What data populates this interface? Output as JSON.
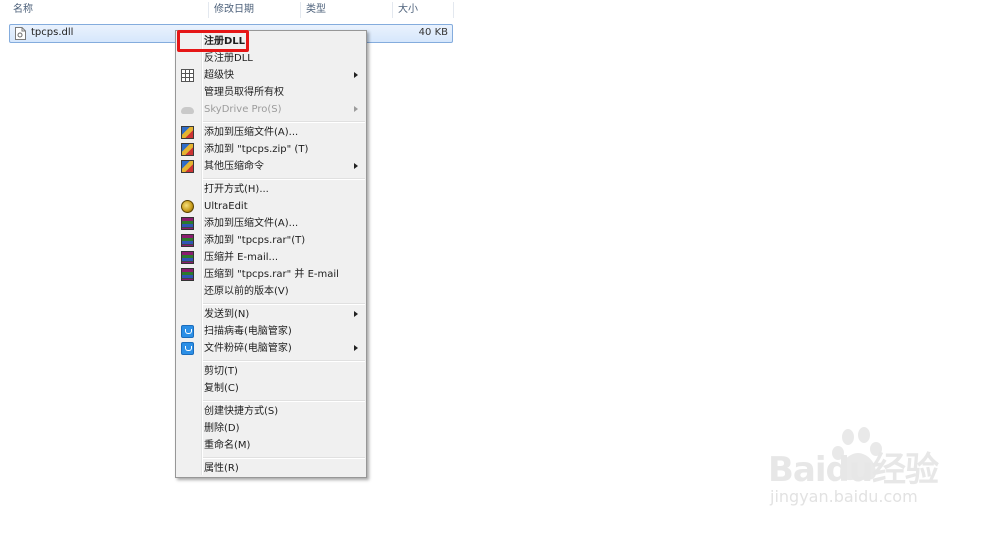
{
  "columns": {
    "name": "名称",
    "modified": "修改日期",
    "type": "类型",
    "size": "大小"
  },
  "file": {
    "name": "tpcps.dll",
    "size": "40 KB",
    "icon": "dll-file-icon"
  },
  "menu": {
    "items": [
      {
        "label": "注册DLL",
        "bold": true,
        "icon": ""
      },
      {
        "label": "反注册DLL",
        "icon": ""
      },
      {
        "label": "超级快",
        "icon": "grid-icon",
        "submenu": true
      },
      {
        "label": "管理员取得所有权",
        "icon": ""
      },
      {
        "label": "SkyDrive Pro(S)",
        "icon": "cloud-icon",
        "submenu": true,
        "disabled": true
      },
      {
        "label": "添加到压缩文件(A)...",
        "icon": "winrar-box-icon"
      },
      {
        "label": "添加到 \"tpcps.zip\" (T)",
        "icon": "winrar-box-icon"
      },
      {
        "label": "其他压缩命令",
        "icon": "winrar-box-icon",
        "submenu": true
      },
      {
        "label": "打开方式(H)...",
        "icon": ""
      },
      {
        "label": "UltraEdit",
        "icon": "ultraedit-icon"
      },
      {
        "label": "添加到压缩文件(A)...",
        "icon": "winrar-books-icon"
      },
      {
        "label": "添加到 \"tpcps.rar\"(T)",
        "icon": "winrar-books-icon"
      },
      {
        "label": "压缩并 E-mail...",
        "icon": "winrar-books-icon"
      },
      {
        "label": "压缩到 \"tpcps.rar\" 并 E-mail",
        "icon": "winrar-books-icon"
      },
      {
        "label": "还原以前的版本(V)",
        "icon": ""
      },
      {
        "label": "发送到(N)",
        "icon": "",
        "submenu": true
      },
      {
        "label": "扫描病毒(电脑管家)",
        "icon": "shield-icon"
      },
      {
        "label": "文件粉碎(电脑管家)",
        "icon": "shield-icon",
        "submenu": true
      },
      {
        "label": "剪切(T)",
        "icon": ""
      },
      {
        "label": "复制(C)",
        "icon": ""
      },
      {
        "label": "创建快捷方式(S)",
        "icon": ""
      },
      {
        "label": "删除(D)",
        "icon": ""
      },
      {
        "label": "重命名(M)",
        "icon": ""
      },
      {
        "label": "属性(R)",
        "icon": ""
      }
    ]
  },
  "watermark": {
    "brand": "Baidu经验",
    "url": "jingyan.baidu.com"
  },
  "colors": {
    "highlight_box": "#e51616",
    "selection": "#d6e7fc"
  }
}
